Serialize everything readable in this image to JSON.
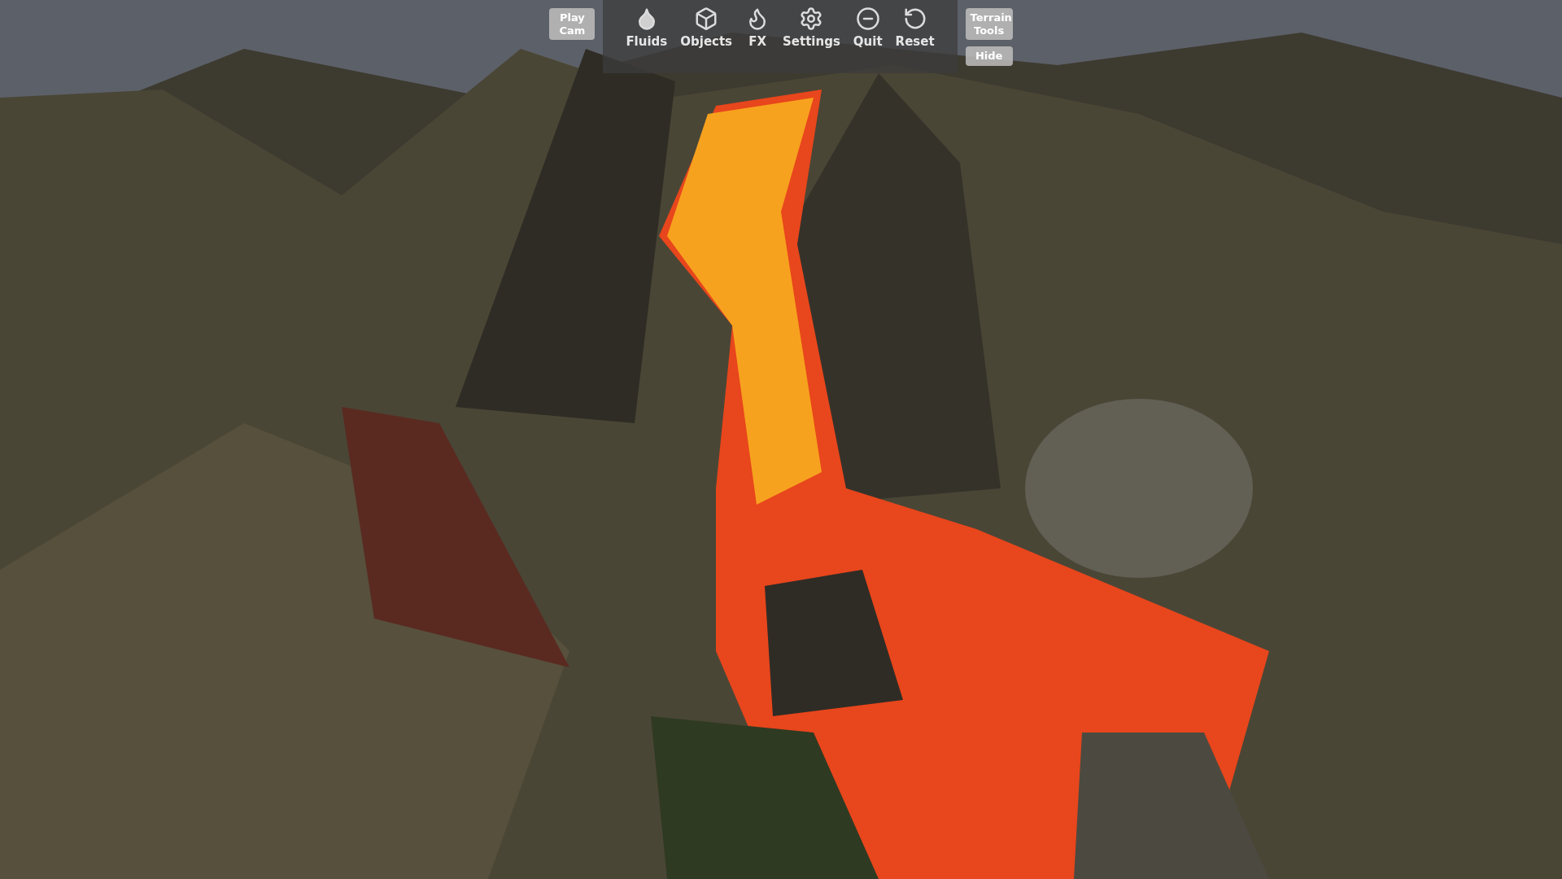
{
  "toolbar": {
    "play_cam": "Play\nCam",
    "tools": [
      {
        "kind": "fluids",
        "label": "Fluids"
      },
      {
        "kind": "objects",
        "label": "Objects"
      },
      {
        "kind": "fx",
        "label": "FX"
      },
      {
        "kind": "settings",
        "label": "Settings"
      },
      {
        "kind": "quit",
        "label": "Quit"
      },
      {
        "kind": "reset",
        "label": "Reset"
      }
    ],
    "terrain_tools": "Terrain\nTools",
    "hide": "Hide"
  }
}
